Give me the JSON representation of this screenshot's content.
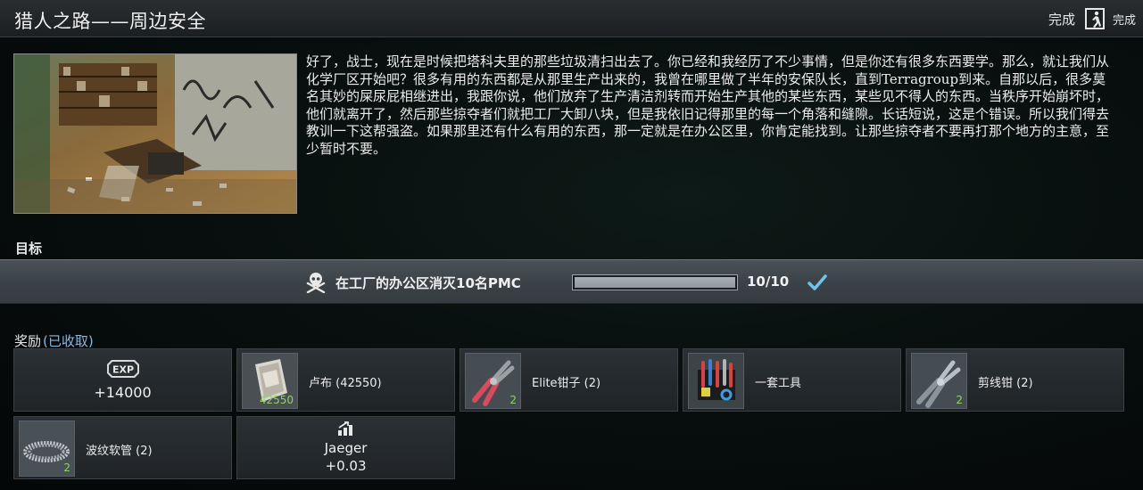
{
  "header": {
    "title": "猎人之路——周边安全",
    "status": "完成",
    "done_button": "完成"
  },
  "description": "好了，战士，现在是时候把塔科夫里的那些垃圾清扫出去了。你已经和我经历了不少事情，但是你还有很多东西要学。那么，就让我们从化学厂区开始吧？很多有用的东西都是从那里生产出来的，我曾在哪里做了半年的安保队长，直到Terragroup到来。自那以后，很多莫名其妙的屎尿屁相继进出，我跟你说，他们放弃了生产清洁剂转而开始生产其他的某些东西，某些见不得人的东西。当秩序开始崩坏时，他们就离开了，然后那些掠夺者们就把工厂大卸八块，但是我依旧记得那里的每一个角落和缝隙。长话短说，这是个错误。所以我们得去教训一下这帮强盗。如果那里还有什么有用的东西，那一定就是在办公区里，你肯定能找到。让那些掠夺者不要再打那个地方的主意，至少暂时不要。",
  "objectives": {
    "label": "目标",
    "items": [
      {
        "icon": "skull-crossbones-icon",
        "text": "在工厂的办公区消灭10名PMC",
        "progress_text": "10/10",
        "progress": 1.0,
        "completed": true
      }
    ]
  },
  "rewards": {
    "label": "奖励",
    "status": "(已收取)",
    "exp": {
      "badge": "EXP",
      "value": "+14000"
    },
    "items": [
      {
        "name": "卢布 (42550)",
        "count": "42550",
        "icon": "rouble-bundle-icon"
      },
      {
        "name": "Elite钳子 (2)",
        "count": "2",
        "icon": "pliers-icon"
      },
      {
        "name": "一套工具",
        "count": "",
        "icon": "toolset-icon"
      },
      {
        "name": "剪线钳 (2)",
        "count": "2",
        "icon": "wire-cutter-icon"
      },
      {
        "name": "波纹软管 (2)",
        "count": "2",
        "icon": "corrugated-hose-icon"
      }
    ],
    "reputation": {
      "icon": "reputation-up-icon",
      "trader": "Jaeger",
      "value": "+0.03"
    }
  },
  "colors": {
    "objective_bar": "#3c4348",
    "check": "#6fc3ef",
    "count_green": "#8fd16a",
    "claimed_blue": "#86b9e0"
  }
}
